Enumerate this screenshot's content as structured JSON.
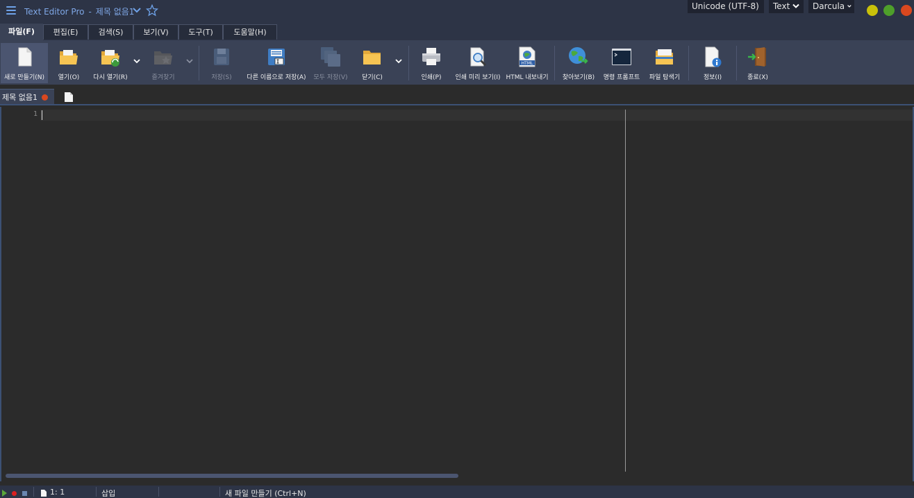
{
  "window": {
    "app_name": "Text Editor Pro",
    "separator": "-",
    "doc_title": "제목 없음1"
  },
  "selectors": {
    "encoding": "Unicode (UTF-8)",
    "language": "Text",
    "theme": "Darcula"
  },
  "menu": {
    "tabs": [
      "파일(F)",
      "편집(E)",
      "검색(S)",
      "보기(V)",
      "도구(T)",
      "도움말(H)"
    ],
    "active_tab": "파일(F)"
  },
  "ribbon": {
    "new": "새로 만들기(N)",
    "open": "열기(O)",
    "reopen": "다시 열기(R)",
    "favorites": "즐겨찾기",
    "save": "저장(S)",
    "save_as": "다른 이름으로 저장(A)",
    "save_all": "모두 저장(V)",
    "close": "닫기(C)",
    "print": "인쇄(P)",
    "print_preview": "인쇄 미리 보기(I)",
    "html_export": "HTML 내보내기",
    "browse": "찾아보기(B)",
    "command_prompt": "명령 프롬프트",
    "file_explorer": "파일 탐색기",
    "info": "정보(I)",
    "exit": "종료(X)",
    "html_icon_text": "HTML"
  },
  "documents": {
    "active": "제목 없음1",
    "modified": true
  },
  "editor": {
    "line_numbers": [
      "1"
    ],
    "content": ""
  },
  "status": {
    "position": "1: 1",
    "mode": "삽입",
    "message": "새 파일 만들기 (Ctrl+N)"
  },
  "colors": {
    "accent": "#6fa3ea",
    "background": "#2b2b2b",
    "chrome": "#2d3446",
    "ribbon": "#3a4256",
    "minimize": "#c9c10a",
    "maximize": "#4e9f2a",
    "close": "#d9481f"
  },
  "icons": {
    "menu": "hamburger-icon",
    "favorite": "star-icon",
    "new": "new-file-icon",
    "open": "open-folder-icon",
    "reopen": "reopen-folder-icon",
    "favorites": "favorites-folder-icon",
    "save": "floppy-disk-icon",
    "save_as": "save-as-icon",
    "save_all": "save-all-icon",
    "close": "close-folder-icon",
    "print": "printer-icon",
    "print_preview": "print-preview-icon",
    "html_export": "html-export-icon",
    "browse": "globe-icon",
    "command_prompt": "terminal-icon",
    "file_explorer": "file-explorer-icon",
    "info": "info-document-icon",
    "exit": "exit-door-icon"
  }
}
